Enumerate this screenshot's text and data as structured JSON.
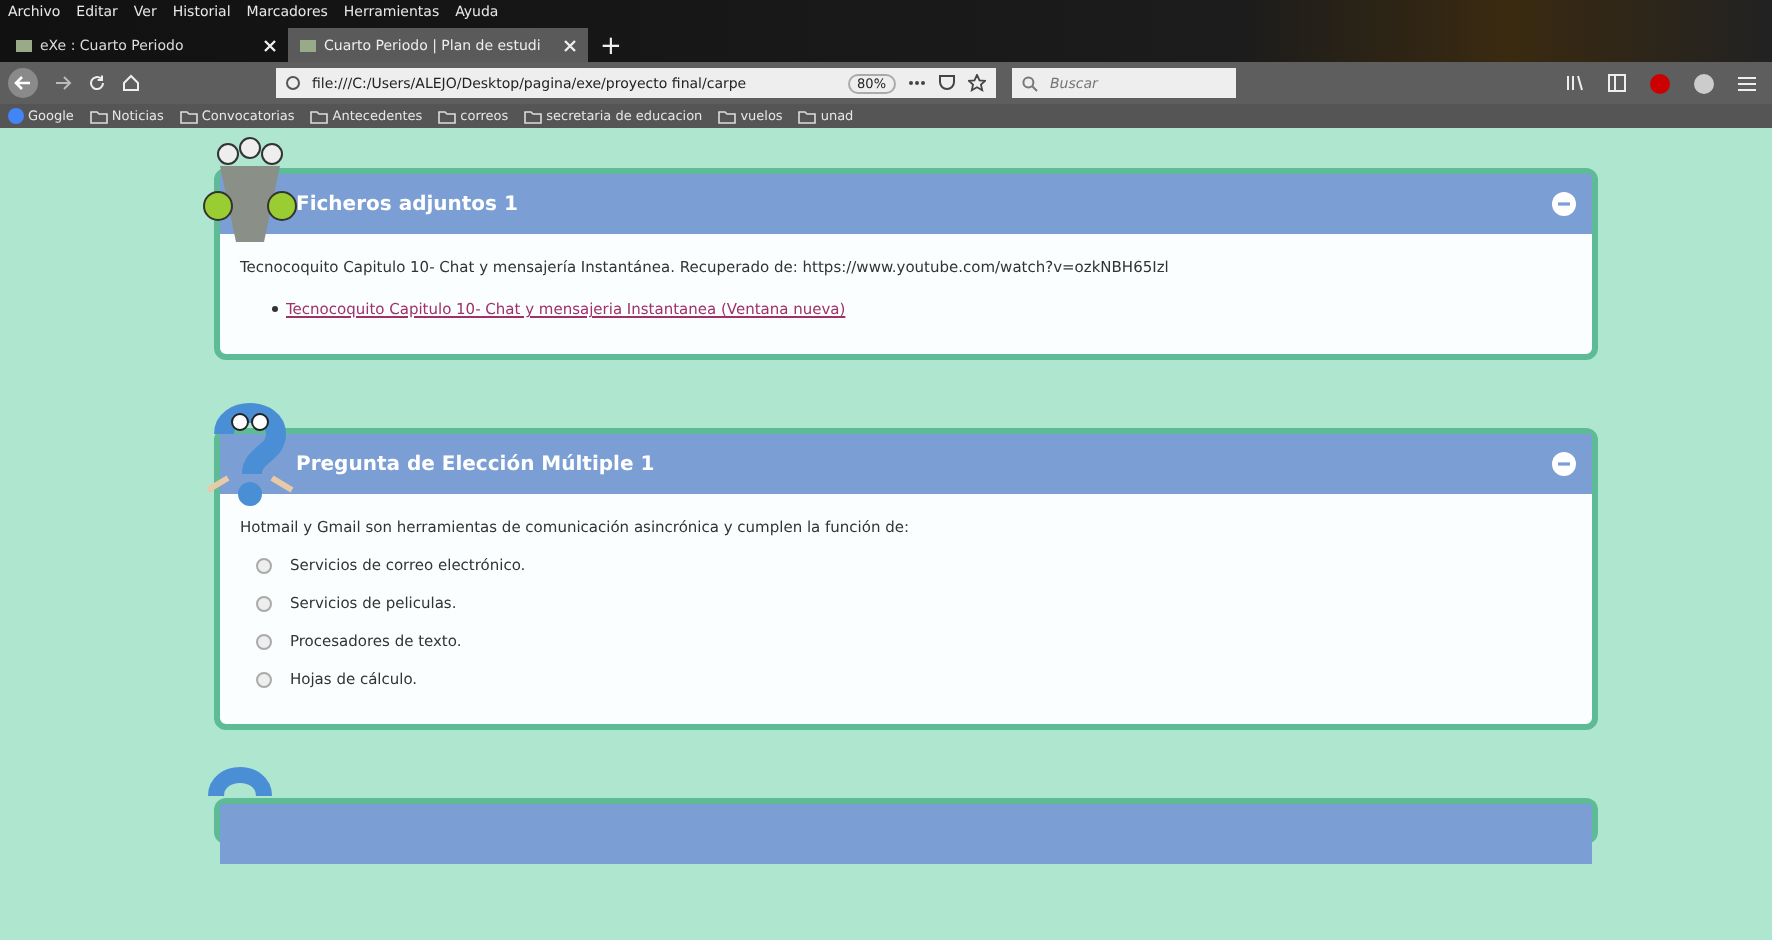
{
  "menu": [
    "Archivo",
    "Editar",
    "Ver",
    "Historial",
    "Marcadores",
    "Herramientas",
    "Ayuda"
  ],
  "tabs": [
    {
      "label": "eXe : Cuarto Periodo",
      "selected": false
    },
    {
      "label": "Cuarto Periodo | Plan de estudi",
      "selected": true
    }
  ],
  "new_tab": "+",
  "address": {
    "url": "file:///C:/Users/ALEJO/Desktop/pagina/exe/proyecto final/carpe",
    "zoom": "80%"
  },
  "search": {
    "placeholder": "Buscar"
  },
  "bookmarks": [
    {
      "label": "Google",
      "kind": "site"
    },
    {
      "label": "Noticias",
      "kind": "folder"
    },
    {
      "label": "Convocatorias",
      "kind": "folder"
    },
    {
      "label": "Antecedentes",
      "kind": "folder"
    },
    {
      "label": "correos",
      "kind": "folder"
    },
    {
      "label": "secretaria de educacion",
      "kind": "folder"
    },
    {
      "label": "vuelos",
      "kind": "folder"
    },
    {
      "label": "unad",
      "kind": "folder"
    }
  ],
  "cards": [
    {
      "kind": "attachments",
      "title": "Ficheros adjuntos 1",
      "text": "Tecnocoquito Capitulo 10- Chat y mensajería Instantánea. Recuperado de: https://www.youtube.com/watch?v=ozkNBH65Izl",
      "links": [
        "Tecnocoquito Capitulo 10- Chat y mensajeria Instantanea (Ventana nueva)"
      ]
    },
    {
      "kind": "quiz",
      "title": "Pregunta de Elección Múltiple 1",
      "question": "Hotmail y Gmail son herramientas de comunicación asincrónica y cumplen la función de:",
      "options": [
        {
          "label": "Servicios de correo electrónico.",
          "selected": false
        },
        {
          "label": "Servicios de peliculas.",
          "selected": false
        },
        {
          "label": "Procesadores de texto.",
          "selected": false
        },
        {
          "label": "Hojas de cálculo.",
          "selected": false
        }
      ]
    },
    {
      "kind": "quiz_partial"
    }
  ]
}
